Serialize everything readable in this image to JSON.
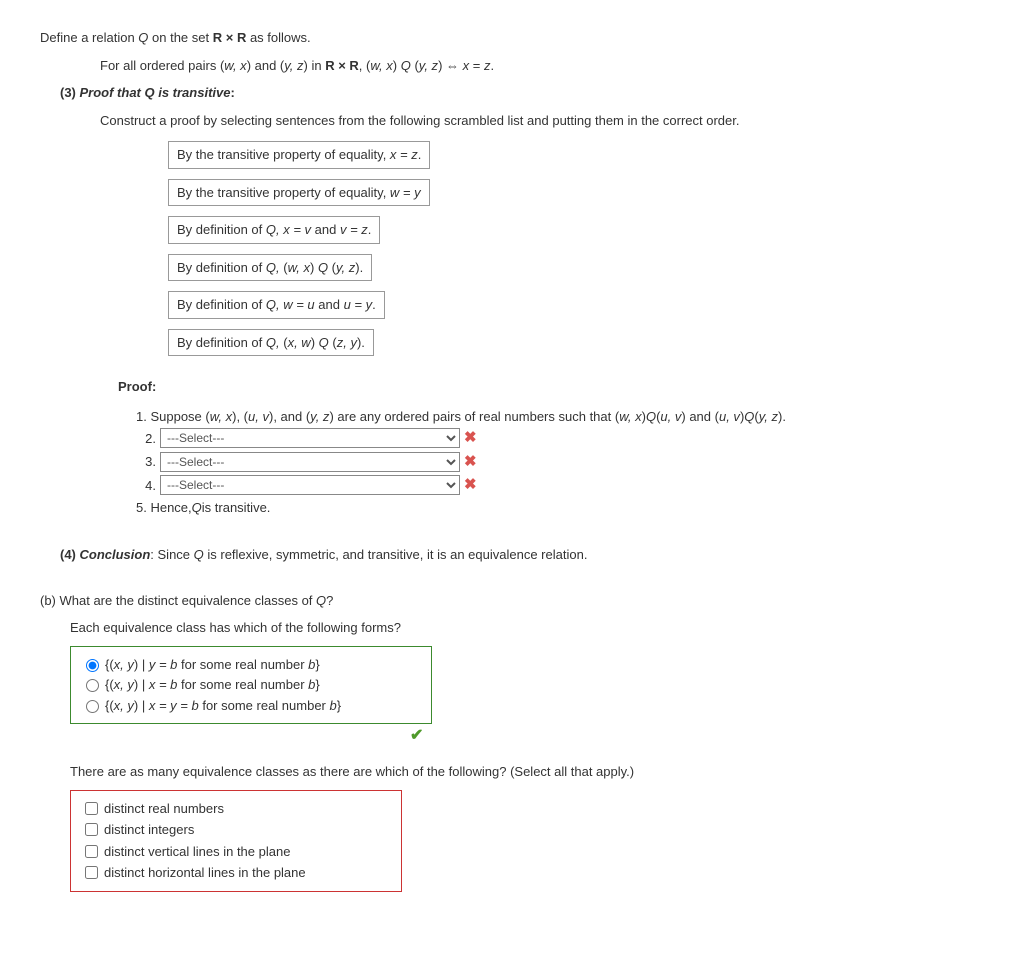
{
  "intro": {
    "line1_a": "Define a relation ",
    "line1_b": " on the set ",
    "line1_c": " as follows.",
    "Q": "Q",
    "RxR": "R × R",
    "for_all_a": "For all ordered pairs (",
    "pair1": "w, x",
    "for_all_b": ") and (",
    "pair2": "y, z",
    "for_all_c": ") in ",
    "for_all_d": ", (",
    "for_all_e": ") ",
    "for_all_f": " (",
    "for_all_g": ")  ⇔  ",
    "for_all_h": " = ",
    "for_all_i": ".",
    "x": "x",
    "z": "z"
  },
  "part3": {
    "label": "(3) ",
    "title": "Proof that Q is transitive",
    "colon": ":",
    "instr": "Construct a proof by selecting sentences from the following scrambled list and putting them in the correct order."
  },
  "sentences": [
    {
      "a": "By the transitive property of equality, ",
      "b": "x = z",
      "c": "."
    },
    {
      "a": "By the transitive property of equality, ",
      "b": "w = y",
      "c": ""
    },
    {
      "a": "By definition of ",
      "b": "Q, x = v ",
      "c": "and ",
      "d": "v = z",
      "e": "."
    },
    {
      "a": "By definition of ",
      "b": "Q, ",
      "c": "(",
      "d": "w, x",
      "e": ") ",
      "f": "Q ",
      "g": "(",
      "h": "y, z",
      "i": ")."
    },
    {
      "a": "By definition of ",
      "b": "Q, w = u ",
      "c": "and ",
      "d": "u = y",
      "e": "."
    },
    {
      "a": "By definition of ",
      "b": "Q, ",
      "c": "(",
      "d": "x, w",
      "e": ") ",
      "f": "Q ",
      "g": "(",
      "h": "z, y",
      "i": ")."
    }
  ],
  "proof": {
    "heading": "Proof:",
    "line1_a": "1. Suppose (",
    "l1_wx": "w, x",
    "l1_b": "), (",
    "l1_uv": "u, v",
    "l1_c": "), and (",
    "l1_yz": "y, z",
    "l1_d": ") are any ordered pairs of real numbers such that (",
    "l1_e": ") ",
    "l1_Q": "Q ",
    "l1_f": "(",
    "l1_g": ") and (",
    "l1_h": ") ",
    "l1_i": "(",
    "l1_j": ").",
    "select_placeholder": "---Select---",
    "nums": [
      "2.",
      "3.",
      "4."
    ],
    "line5": "5. Hence, ",
    "line5_q": "Q",
    "line5_end": " is transitive."
  },
  "part4": {
    "label": "(4) ",
    "title": "Conclusion",
    "text_a": ": Since ",
    "text_q": "Q",
    "text_b": " is reflexive, symmetric, and transitive, it is an equivalence relation."
  },
  "partb": {
    "label": "(b) ",
    "text_a": "What are the distinct equivalence classes of ",
    "text_q": "Q",
    "text_b": "?",
    "sub": "Each equivalence class has which of the following forms?"
  },
  "radios": [
    {
      "a": "{(",
      "b": "x, y",
      "c": ") | ",
      "d": "y = b",
      "e": " for some real number ",
      "f": "b",
      "g": "}"
    },
    {
      "a": "{(",
      "b": "x, y",
      "c": ") | ",
      "d": "x = b",
      "e": " for some real number ",
      "f": "b",
      "g": "}"
    },
    {
      "a": "{(",
      "b": "x, y",
      "c": ") | ",
      "d": "x = y = b",
      "e": " for some real number ",
      "f": "b",
      "g": "}"
    }
  ],
  "cb_prompt": "There are as many equivalence classes as there are which of the following? (Select all that apply.)",
  "checkboxes": [
    "distinct real numbers",
    "distinct integers",
    "distinct vertical lines in the plane",
    "distinct horizontal lines in the plane"
  ]
}
